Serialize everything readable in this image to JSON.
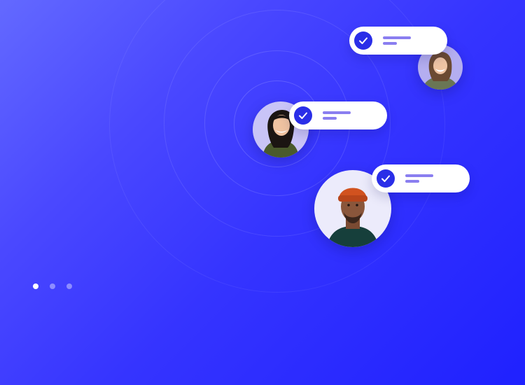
{
  "illustration": {
    "avatars": [
      {
        "name": "avatar-woman-dark-hair",
        "description_icon": "person-photo"
      },
      {
        "name": "avatar-woman-laughing",
        "description_icon": "person-photo"
      },
      {
        "name": "avatar-man-beanie",
        "description_icon": "person-photo"
      }
    ],
    "cards": [
      {
        "icon": "check-circle-icon",
        "status": "verified"
      },
      {
        "icon": "check-circle-icon",
        "status": "verified"
      },
      {
        "icon": "check-circle-icon",
        "status": "verified"
      }
    ]
  },
  "carousel": {
    "slide_count": 3,
    "active_index": 0
  },
  "colors": {
    "background_start": "#6369ff",
    "background_end": "#1f21ff",
    "card_background": "#ffffff",
    "check_badge": "#2a2ee8",
    "placeholder_line": "#8a7ef0",
    "dot_active": "#ffffff"
  }
}
